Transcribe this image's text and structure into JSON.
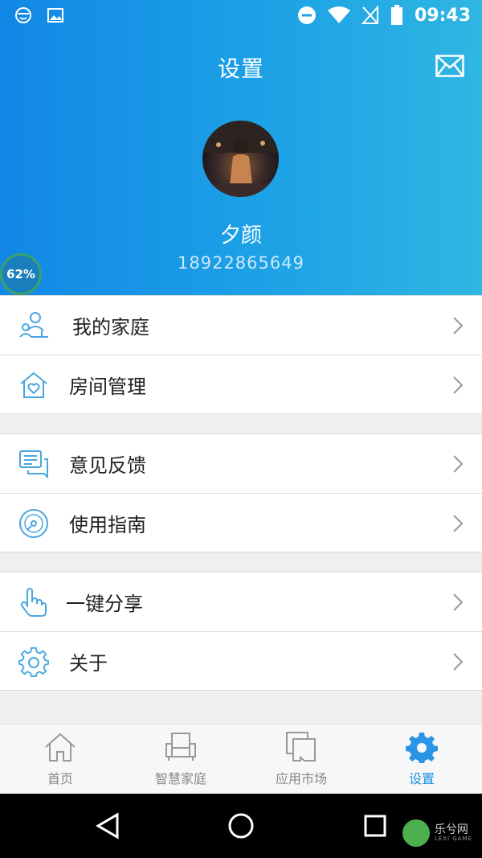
{
  "status_bar": {
    "time": "09:43"
  },
  "header": {
    "title": "设置",
    "username": "夕颜",
    "phone": "18922865649",
    "progress_badge": "62%"
  },
  "menu": {
    "group1": [
      {
        "label": "我的家庭",
        "icon": "family-icon"
      },
      {
        "label": "房间管理",
        "icon": "house-heart-icon"
      }
    ],
    "group2": [
      {
        "label": "意见反馈",
        "icon": "feedback-chat-icon"
      },
      {
        "label": "使用指南",
        "icon": "guide-disc-icon"
      }
    ],
    "group3": [
      {
        "label": "一键分享",
        "icon": "tap-finger-icon"
      },
      {
        "label": "关于",
        "icon": "gear-outline-icon"
      }
    ]
  },
  "tabbar": {
    "tabs": [
      {
        "label": "首页",
        "icon": "home-icon"
      },
      {
        "label": "智慧家庭",
        "icon": "sofa-icon"
      },
      {
        "label": "应用市场",
        "icon": "apps-cards-icon"
      },
      {
        "label": "设置",
        "icon": "gear-icon"
      }
    ],
    "active_index": 3
  },
  "watermark": {
    "text": "乐兮网",
    "sub": "LEXI GAME"
  },
  "colors": {
    "accent": "#1a90e0",
    "header_start": "#1287e6",
    "header_end": "#2fb6e2",
    "icon_blue": "#4aa6e0"
  }
}
